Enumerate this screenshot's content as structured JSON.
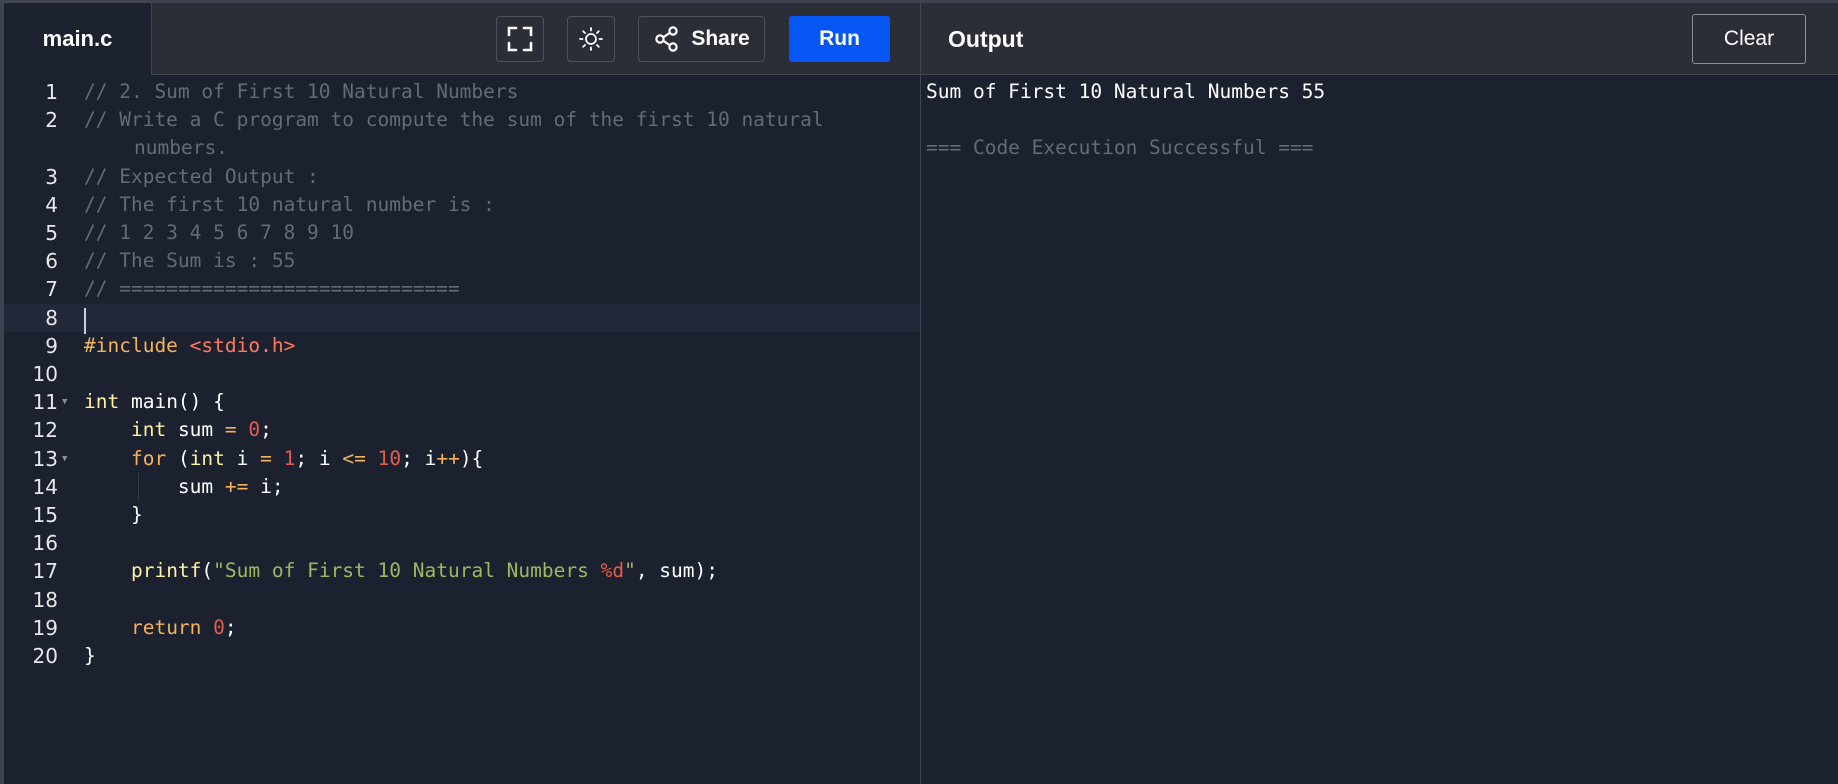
{
  "editor": {
    "filename": "main.c",
    "run_label": "Run",
    "share_label": "Share",
    "lines": [
      {
        "n": "1",
        "parts": [
          {
            "c": "cm",
            "t": "// 2. Sum of First 10 Natural Numbers"
          }
        ]
      },
      {
        "n": "2",
        "parts": [
          {
            "c": "cm",
            "t": "// Write a C program to compute the sum of the first 10 natural"
          }
        ],
        "cont": "numbers."
      },
      {
        "n": "3",
        "parts": [
          {
            "c": "cm",
            "t": "// Expected Output :"
          }
        ]
      },
      {
        "n": "4",
        "parts": [
          {
            "c": "cm",
            "t": "// The first 10 natural number is :"
          }
        ]
      },
      {
        "n": "5",
        "parts": [
          {
            "c": "cm",
            "t": "// 1 2 3 4 5 6 7 8 9 10"
          }
        ]
      },
      {
        "n": "6",
        "parts": [
          {
            "c": "cm",
            "t": "// The Sum is : 55"
          }
        ]
      },
      {
        "n": "7",
        "parts": [
          {
            "c": "cm",
            "t": "// ============================="
          }
        ]
      },
      {
        "n": "8",
        "parts": [],
        "active": true
      },
      {
        "n": "9",
        "parts": [
          {
            "c": "pp",
            "t": "#include "
          },
          {
            "c": "hd",
            "t": "<stdio.h>"
          }
        ]
      },
      {
        "n": "10",
        "parts": []
      },
      {
        "n": "11",
        "fold": true,
        "parts": [
          {
            "c": "kw",
            "t": "int"
          },
          {
            "c": "tx",
            "t": " main() {"
          }
        ]
      },
      {
        "n": "12",
        "parts": [
          {
            "c": "tx",
            "t": "    "
          },
          {
            "c": "kw",
            "t": "int"
          },
          {
            "c": "tx",
            "t": " sum "
          },
          {
            "c": "op",
            "t": "="
          },
          {
            "c": "tx",
            "t": " "
          },
          {
            "c": "nm",
            "t": "0"
          },
          {
            "c": "tx",
            "t": ";"
          }
        ]
      },
      {
        "n": "13",
        "fold": true,
        "parts": [
          {
            "c": "tx",
            "t": "    "
          },
          {
            "c": "fl",
            "t": "for"
          },
          {
            "c": "tx",
            "t": " ("
          },
          {
            "c": "kw",
            "t": "int"
          },
          {
            "c": "tx",
            "t": " i "
          },
          {
            "c": "op",
            "t": "="
          },
          {
            "c": "tx",
            "t": " "
          },
          {
            "c": "nm",
            "t": "1"
          },
          {
            "c": "tx",
            "t": "; i "
          },
          {
            "c": "op",
            "t": "<="
          },
          {
            "c": "tx",
            "t": " "
          },
          {
            "c": "nm",
            "t": "10"
          },
          {
            "c": "tx",
            "t": "; i"
          },
          {
            "c": "op",
            "t": "++"
          },
          {
            "c": "tx",
            "t": "){"
          }
        ]
      },
      {
        "n": "14",
        "guide": true,
        "parts": [
          {
            "c": "tx",
            "t": "        sum "
          },
          {
            "c": "op",
            "t": "+="
          },
          {
            "c": "tx",
            "t": " i;"
          }
        ]
      },
      {
        "n": "15",
        "parts": [
          {
            "c": "tx",
            "t": "    }"
          }
        ]
      },
      {
        "n": "16",
        "parts": []
      },
      {
        "n": "17",
        "parts": [
          {
            "c": "tx",
            "t": "    "
          },
          {
            "c": "fn",
            "t": "printf"
          },
          {
            "c": "tx",
            "t": "("
          },
          {
            "c": "st",
            "t": "\"Sum of First 10 Natural Numbers "
          },
          {
            "c": "nm",
            "t": "%d"
          },
          {
            "c": "st",
            "t": "\""
          },
          {
            "c": "tx",
            "t": ", sum);"
          }
        ]
      },
      {
        "n": "18",
        "parts": []
      },
      {
        "n": "19",
        "parts": [
          {
            "c": "tx",
            "t": "    "
          },
          {
            "c": "fl",
            "t": "return"
          },
          {
            "c": "tx",
            "t": " "
          },
          {
            "c": "nm",
            "t": "0"
          },
          {
            "c": "tx",
            "t": ";"
          }
        ]
      },
      {
        "n": "20",
        "parts": [
          {
            "c": "tx",
            "t": "}"
          }
        ]
      }
    ]
  },
  "output": {
    "title": "Output",
    "clear_label": "Clear",
    "lines": [
      {
        "text": "Sum of First 10 Natural Numbers 55",
        "color": "#ffffff"
      },
      {
        "text": "",
        "color": "#ffffff"
      },
      {
        "text": "=== Code Execution Successful ===",
        "color": "#646a78"
      }
    ]
  },
  "colors": {
    "run_button": "#0556f3",
    "editor_bg": "#1c2130",
    "toolbar_bg": "#2b2e36"
  },
  "icons": {
    "fullscreen": "fullscreen-icon",
    "theme": "sun-icon",
    "share": "share-icon"
  }
}
